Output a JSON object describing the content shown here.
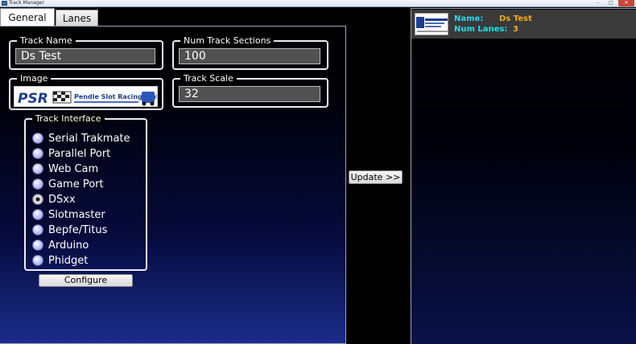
{
  "window": {
    "title": "Track Manager",
    "min": "–",
    "max": "□",
    "close": "✕"
  },
  "tabs": [
    {
      "label": "General",
      "active": true
    },
    {
      "label": "Lanes",
      "active": false
    }
  ],
  "general": {
    "track_name": {
      "legend": "Track Name",
      "value": "Ds Test"
    },
    "num_sections": {
      "legend": "Num Track Sections",
      "value": "100"
    },
    "image": {
      "legend": "Image",
      "logo_text": "Pendle Slot Racing Club",
      "logo_abbr": "PSR"
    },
    "track_scale": {
      "legend": "Track Scale",
      "value": "32"
    },
    "track_interface": {
      "legend": "Track Interface",
      "options": [
        "Serial Trakmate",
        "Parallel Port",
        "Web Cam",
        "Game Port",
        "DSxx",
        "Slotmaster",
        "Bepfe/Titus",
        "Arduino",
        "Phidget"
      ],
      "selected": "DSxx"
    },
    "configure_label": "Configure"
  },
  "update_label": "Update >>",
  "summary": {
    "name_key": "Name:",
    "name_val": "Ds Test",
    "lanes_key": "Num Lanes:",
    "lanes_val": "3"
  },
  "colors": {
    "accent_cyan": "#1ee0e8",
    "accent_orange": "#f5a623",
    "panel_bottom": "#1a2c8a"
  }
}
